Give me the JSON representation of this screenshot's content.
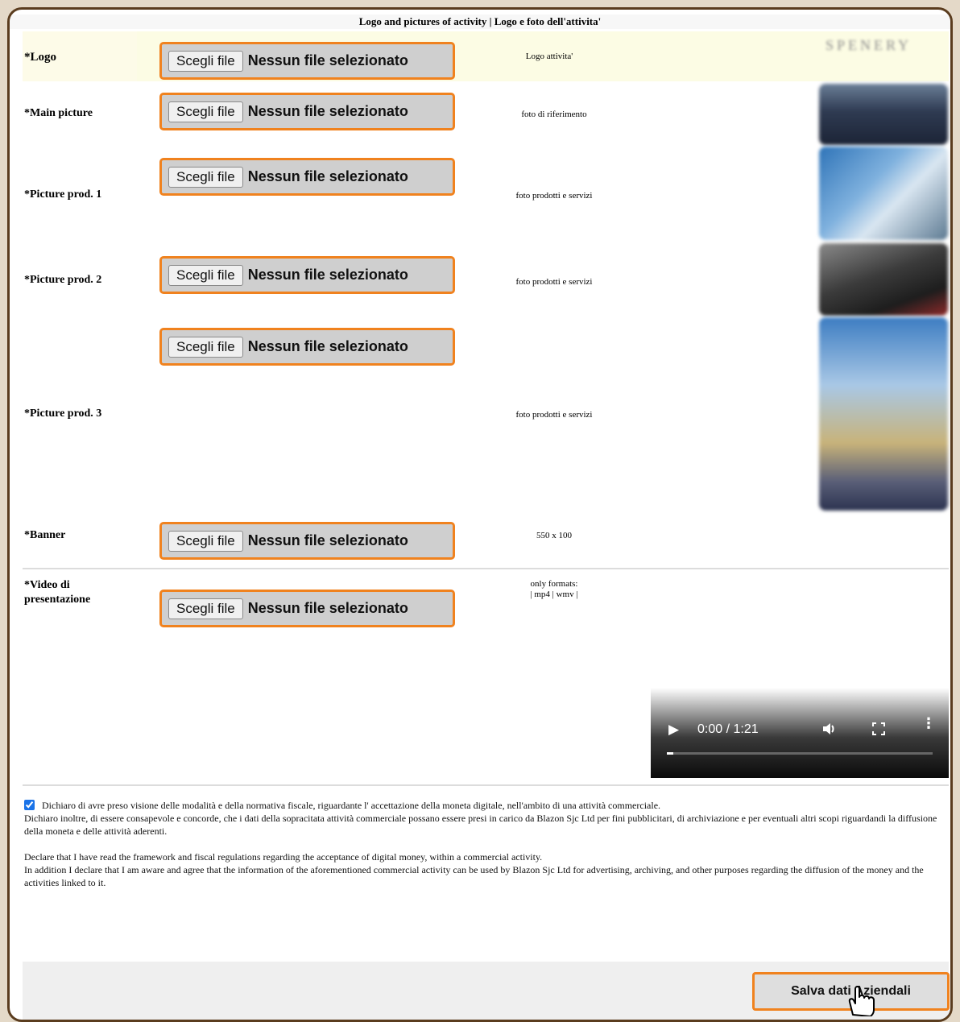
{
  "header": {
    "title": "Logo and pictures of activity | Logo e foto dell'attivita'"
  },
  "file_input": {
    "button_label": "Scegli file",
    "status": "Nessun file selezionato"
  },
  "rows": {
    "logo": {
      "label": "*Logo",
      "note": "Logo attivita'"
    },
    "main_picture": {
      "label": "*Main picture",
      "note": "foto di riferimento"
    },
    "picture_prod_1": {
      "label": "*Picture prod. 1",
      "note": "foto prodotti e servizi"
    },
    "picture_prod_2": {
      "label": "*Picture prod. 2",
      "note": "foto prodotti e servizi"
    },
    "picture_prod_3": {
      "label": "*Picture prod. 3",
      "note": "foto prodotti e servizi"
    },
    "banner": {
      "label": "*Banner",
      "note": "550 x 100"
    },
    "video": {
      "label_line1": "*Video di",
      "label_line2": "presentazione",
      "note_line1": "only formats:",
      "note_line2": "| mp4 | wmv |"
    }
  },
  "video_player": {
    "time": "0:00 / 1:21",
    "progress": 0
  },
  "declaration": {
    "checked": true,
    "it_line1": "Dichiaro di avre preso visione delle modalità e della normativa fiscale, riguardante l' accettazione della moneta digitale, nell'ambito di una attività commerciale.",
    "it_line2": "Dichiaro inoltre, di essere consapevole e concorde, che i dati della sopracitata attività commerciale possano essere presi in carico da Blazon Sjc Ltd per fini pubblicitari, di archiviazione e per eventuali altri scopi riguardandi la diffusione della moneta e delle attività aderenti.",
    "en_line1": "Declare that I have read the framework and fiscal regulations regarding the acceptance of digital money, within a commercial activity.",
    "en_line2": "In addition I declare that I am aware and agree that the information of the aforementioned commercial activity can be used by Blazon Sjc Ltd for advertising, archiving, and other purposes regarding the diffusion of the money and the activities linked to it."
  },
  "footer": {
    "save_label": "Salva dati Aziendali"
  },
  "colors": {
    "accent": "#f0821e",
    "frame": "#5a3c1e"
  }
}
